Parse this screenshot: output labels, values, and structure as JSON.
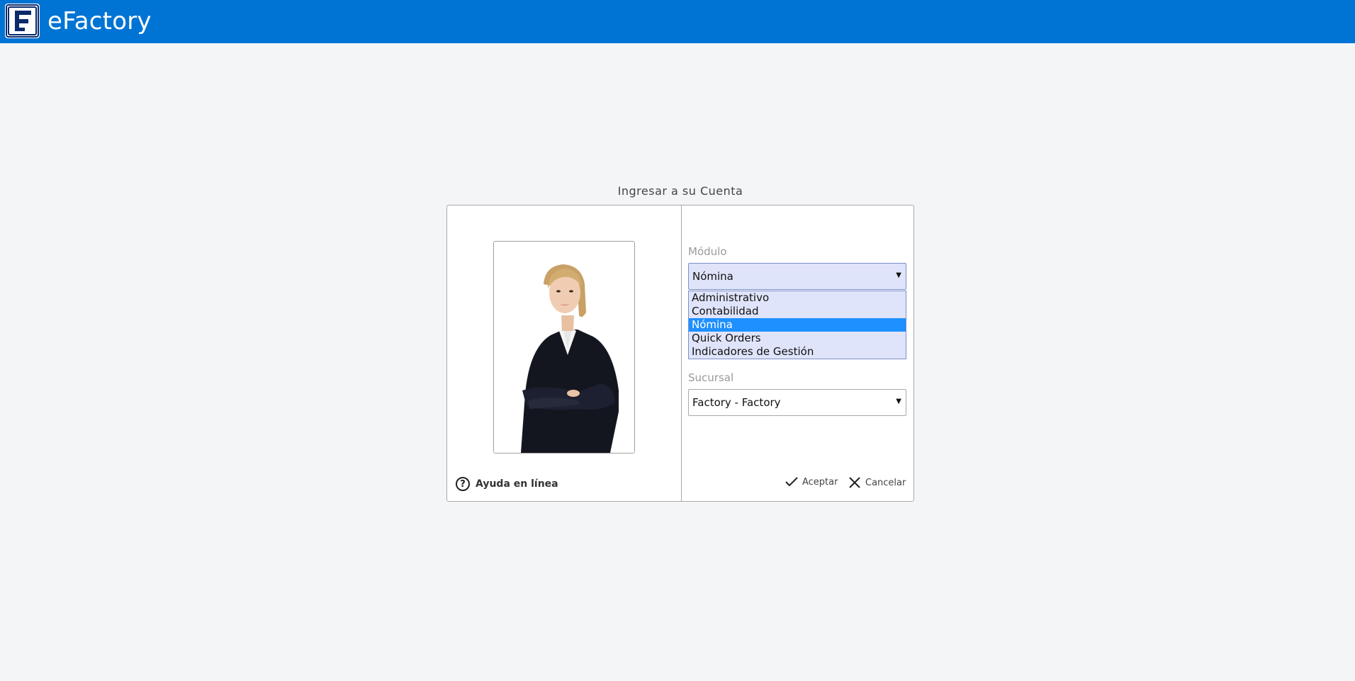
{
  "app": {
    "title": "eFactory"
  },
  "dialog": {
    "title": "Ingresar a su Cuenta",
    "help_label": "Ayuda en línea",
    "modulo": {
      "label": "Módulo",
      "selected": "Nómina",
      "options": [
        "Administrativo",
        "Contabilidad",
        "Nómina",
        "Quick Orders",
        "Indicadores de Gestión"
      ]
    },
    "sucursal": {
      "label": "Sucursal",
      "selected": "Factory - Factory"
    },
    "accept_label": "Aceptar",
    "cancel_label": "Cancelar"
  },
  "colors": {
    "topbar": "#0074d4",
    "selected_option": "#1e90ff",
    "dropdown_bg": "#e0e4fa"
  }
}
